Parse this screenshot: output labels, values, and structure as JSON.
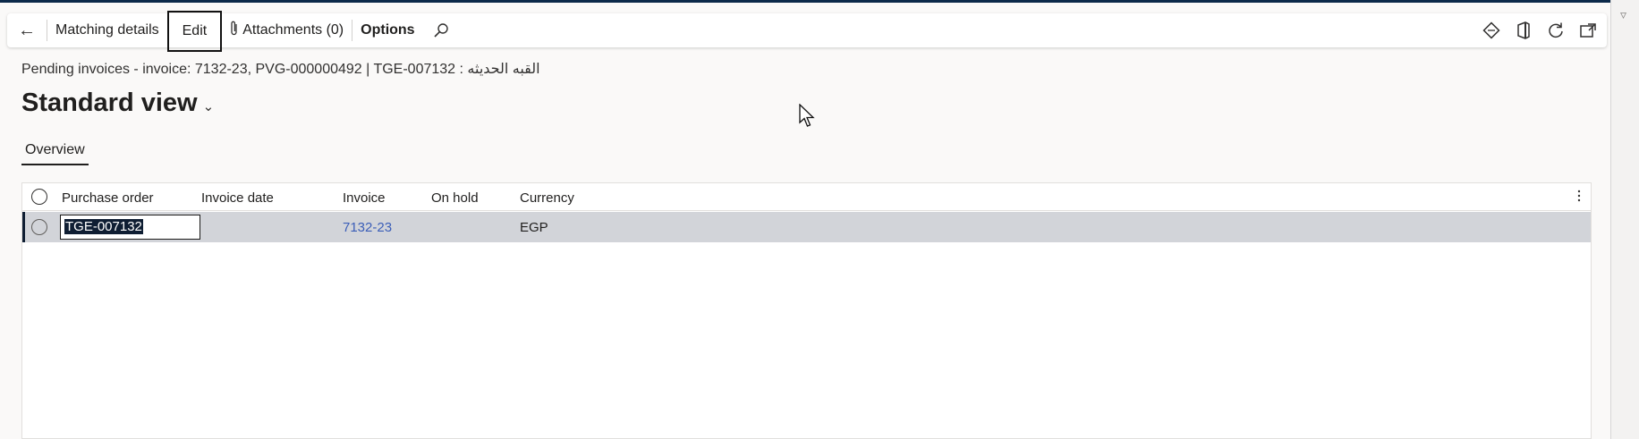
{
  "actionbar": {
    "matching_details": "Matching details",
    "edit": "Edit",
    "attachments": "Attachments (0)",
    "options": "Options"
  },
  "header": {
    "caption": "Pending invoices - invoice: 7132-23, PVG-000000492  |  TGE-007132 : القبه الحديثه",
    "view_title": "Standard view"
  },
  "tabs": [
    {
      "label": "Overview"
    }
  ],
  "grid": {
    "columns": [
      "Purchase order",
      "Invoice date",
      "Invoice",
      "On hold",
      "Currency"
    ],
    "rows": [
      {
        "purchase_order": "TGE-007132",
        "invoice_date": "",
        "invoice": "7132-23",
        "on_hold": "",
        "currency": "EGP"
      }
    ]
  },
  "icons": {
    "back": "back-arrow-icon",
    "attachment": "paperclip-icon",
    "search": "search-icon",
    "right": [
      "diamond-icon",
      "office-icon",
      "refresh-icon",
      "open-new-window-icon"
    ],
    "more": "more-vertical-icon"
  },
  "colors": {
    "selected_row": "#d2d4d9",
    "link": "#3b5eb8",
    "selection_highlight": "#0f1e33"
  }
}
